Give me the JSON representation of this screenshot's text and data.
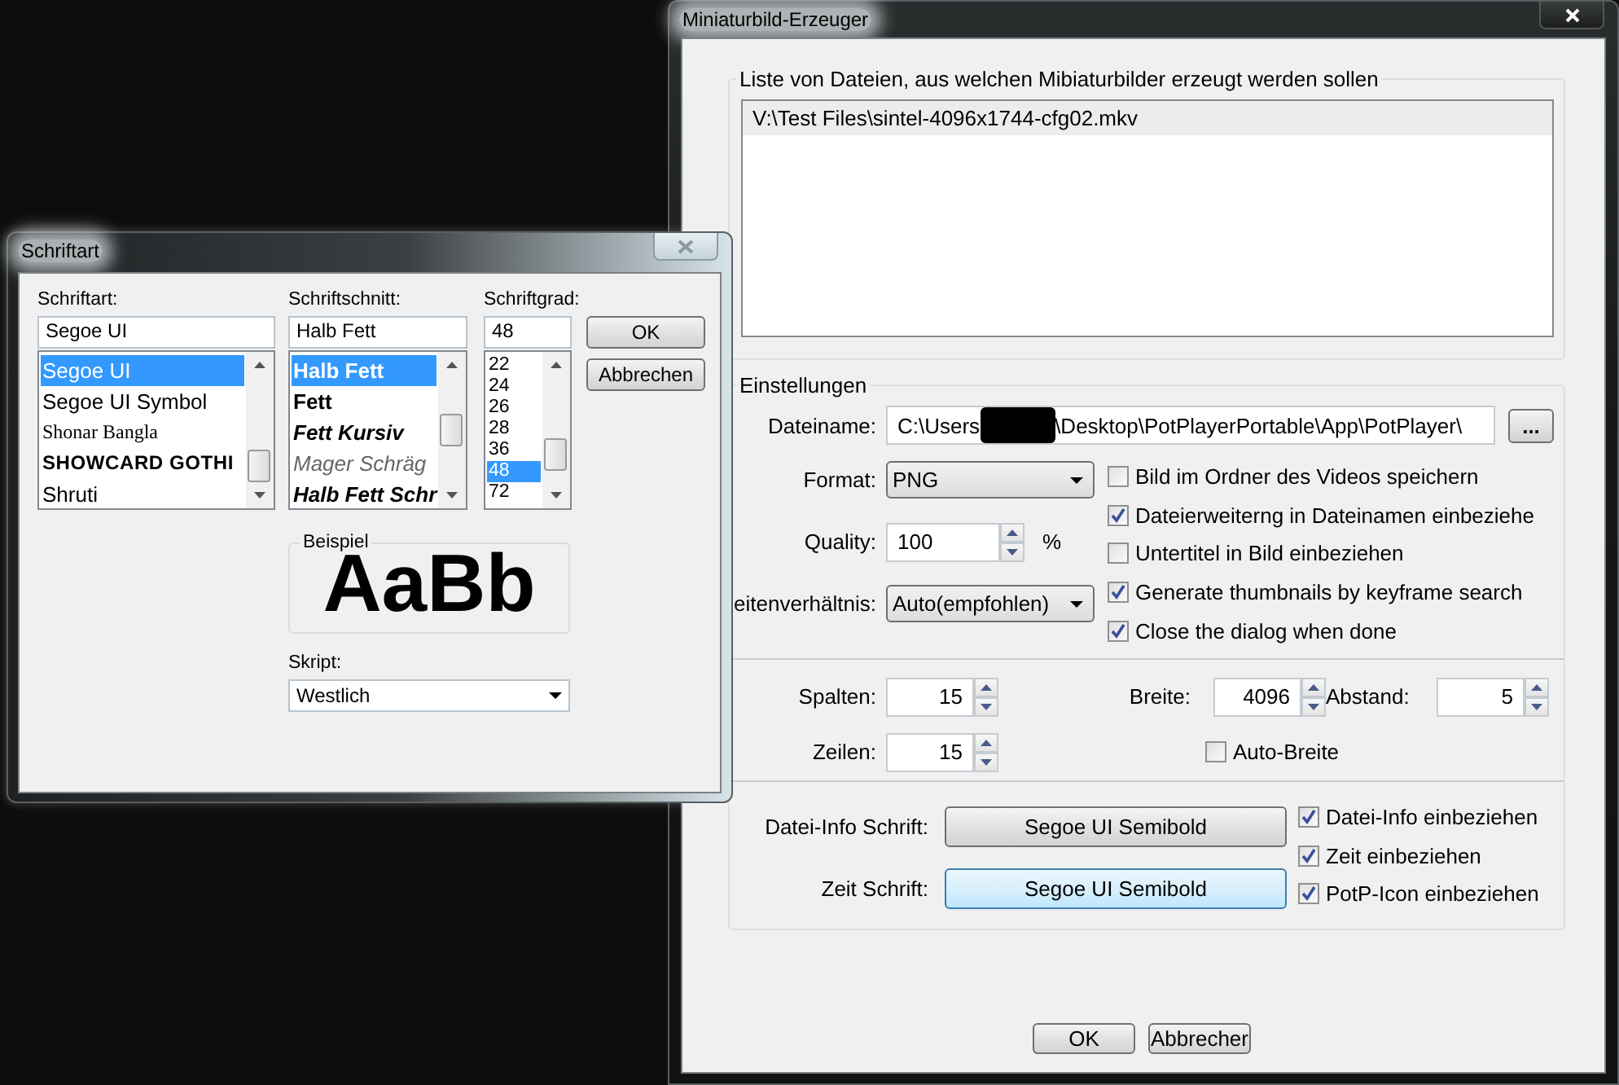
{
  "main_window": {
    "title": "Miniaturbild-Erzeuger",
    "file_list": {
      "legend": "Liste von Dateien, aus welchen Mibiaturbilder erzeugt werden sollen",
      "items": [
        {
          "text": "V:\\Test Files\\sintel-4096x1744-cfg02.mkv",
          "selected": true
        }
      ]
    },
    "settings": {
      "legend": "Einstellungen",
      "filename": {
        "label": "Dateiname:",
        "value_start": "C:\\Users",
        "redacted": true,
        "value_end": "\\Desktop\\PotPlayerPortable\\App\\PotPlayer\\",
        "browse": "..."
      },
      "format": {
        "label": "Format:",
        "value": "PNG"
      },
      "quality": {
        "label": "Quality:",
        "value": "100",
        "unit": "%"
      },
      "aspect": {
        "label": "eitenverhältnis:",
        "value": "Auto(empfohlen)"
      },
      "options": [
        {
          "label": "Bild im Ordner des Videos speichern",
          "checked": false
        },
        {
          "label": "Dateierweiterng in Dateinamen einbeziehe",
          "checked": true
        },
        {
          "label": "Untertitel in Bild einbeziehen",
          "checked": false
        },
        {
          "label": "Generate thumbnails by keyframe search",
          "checked": true
        },
        {
          "label": "Close the dialog when done",
          "checked": true
        }
      ],
      "columns": {
        "label": "Spalten:",
        "value": "15"
      },
      "rows": {
        "label": "Zeilen:",
        "value": "15"
      },
      "width": {
        "label": "Breite:",
        "value": "4096"
      },
      "spacing": {
        "label": "Abstand:",
        "value": "5"
      },
      "auto_width": {
        "label": "Auto-Breite",
        "checked": false
      },
      "font_buttons": [
        {
          "label": "Datei-Info Schrift:",
          "value": "Segoe UI Semibold",
          "selected": false
        },
        {
          "label": "Zeit Schrift:",
          "value": "Segoe UI Semibold",
          "selected": true
        }
      ],
      "include_options": [
        {
          "label": "Datei-Info einbeziehen",
          "checked": true
        },
        {
          "label": "Zeit einbeziehen",
          "checked": true
        },
        {
          "label": "PotP-Icon einbeziehen",
          "checked": true
        }
      ]
    },
    "buttons": [
      "OK",
      "Abbrecher"
    ]
  },
  "font_dialog": {
    "title": "Schriftart",
    "font": {
      "label": "Schriftart:",
      "value": "Segoe UI",
      "items": [
        {
          "text": "Segoe UI",
          "kind": "sans",
          "selected": true
        },
        {
          "text": "Segoe UI Symbol",
          "kind": "sans",
          "selected": false
        },
        {
          "text": "Shonar Bangla",
          "kind": "serif",
          "selected": false
        },
        {
          "text": "SHOWCARD GOTHI",
          "kind": "display",
          "selected": false
        },
        {
          "text": "Shruti",
          "kind": "sans",
          "selected": false
        }
      ]
    },
    "style": {
      "label": "Schriftschnitt:",
      "value": "Halb Fett",
      "items": [
        {
          "text": "Halb Fett",
          "kind": "semibold",
          "selected": true
        },
        {
          "text": "Fett",
          "kind": "bold",
          "selected": false
        },
        {
          "text": "Fett Kursiv",
          "kind": "bold-italic",
          "selected": false
        },
        {
          "text": "Mager Schräg",
          "kind": "light-italic",
          "selected": false
        },
        {
          "text": "Halb Fett Schr",
          "kind": "bold-italic",
          "selected": false
        }
      ]
    },
    "size": {
      "label": "Schriftgrad:",
      "value": "48",
      "items": [
        {
          "text": "22",
          "selected": false
        },
        {
          "text": "24",
          "selected": false
        },
        {
          "text": "26",
          "selected": false
        },
        {
          "text": "28",
          "selected": false
        },
        {
          "text": "36",
          "selected": false
        },
        {
          "text": "48",
          "selected": true
        },
        {
          "text": "72",
          "selected": false
        }
      ]
    },
    "buttons": [
      "OK",
      "Abbrechen"
    ],
    "sample": {
      "legend": "Beispiel",
      "text": "AaBb"
    },
    "script": {
      "label": "Skript:",
      "value": "Westlich"
    }
  }
}
